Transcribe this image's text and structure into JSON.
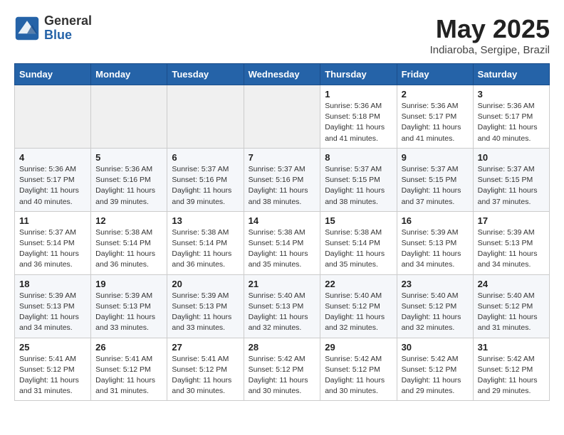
{
  "logo": {
    "general": "General",
    "blue": "Blue"
  },
  "header": {
    "month": "May 2025",
    "location": "Indiaroba, Sergipe, Brazil"
  },
  "days_of_week": [
    "Sunday",
    "Monday",
    "Tuesday",
    "Wednesday",
    "Thursday",
    "Friday",
    "Saturday"
  ],
  "weeks": [
    [
      {
        "day": "",
        "info": ""
      },
      {
        "day": "",
        "info": ""
      },
      {
        "day": "",
        "info": ""
      },
      {
        "day": "",
        "info": ""
      },
      {
        "day": "1",
        "info": "Sunrise: 5:36 AM\nSunset: 5:18 PM\nDaylight: 11 hours\nand 41 minutes."
      },
      {
        "day": "2",
        "info": "Sunrise: 5:36 AM\nSunset: 5:17 PM\nDaylight: 11 hours\nand 41 minutes."
      },
      {
        "day": "3",
        "info": "Sunrise: 5:36 AM\nSunset: 5:17 PM\nDaylight: 11 hours\nand 40 minutes."
      }
    ],
    [
      {
        "day": "4",
        "info": "Sunrise: 5:36 AM\nSunset: 5:17 PM\nDaylight: 11 hours\nand 40 minutes."
      },
      {
        "day": "5",
        "info": "Sunrise: 5:36 AM\nSunset: 5:16 PM\nDaylight: 11 hours\nand 39 minutes."
      },
      {
        "day": "6",
        "info": "Sunrise: 5:37 AM\nSunset: 5:16 PM\nDaylight: 11 hours\nand 39 minutes."
      },
      {
        "day": "7",
        "info": "Sunrise: 5:37 AM\nSunset: 5:16 PM\nDaylight: 11 hours\nand 38 minutes."
      },
      {
        "day": "8",
        "info": "Sunrise: 5:37 AM\nSunset: 5:15 PM\nDaylight: 11 hours\nand 38 minutes."
      },
      {
        "day": "9",
        "info": "Sunrise: 5:37 AM\nSunset: 5:15 PM\nDaylight: 11 hours\nand 37 minutes."
      },
      {
        "day": "10",
        "info": "Sunrise: 5:37 AM\nSunset: 5:15 PM\nDaylight: 11 hours\nand 37 minutes."
      }
    ],
    [
      {
        "day": "11",
        "info": "Sunrise: 5:37 AM\nSunset: 5:14 PM\nDaylight: 11 hours\nand 36 minutes."
      },
      {
        "day": "12",
        "info": "Sunrise: 5:38 AM\nSunset: 5:14 PM\nDaylight: 11 hours\nand 36 minutes."
      },
      {
        "day": "13",
        "info": "Sunrise: 5:38 AM\nSunset: 5:14 PM\nDaylight: 11 hours\nand 36 minutes."
      },
      {
        "day": "14",
        "info": "Sunrise: 5:38 AM\nSunset: 5:14 PM\nDaylight: 11 hours\nand 35 minutes."
      },
      {
        "day": "15",
        "info": "Sunrise: 5:38 AM\nSunset: 5:14 PM\nDaylight: 11 hours\nand 35 minutes."
      },
      {
        "day": "16",
        "info": "Sunrise: 5:39 AM\nSunset: 5:13 PM\nDaylight: 11 hours\nand 34 minutes."
      },
      {
        "day": "17",
        "info": "Sunrise: 5:39 AM\nSunset: 5:13 PM\nDaylight: 11 hours\nand 34 minutes."
      }
    ],
    [
      {
        "day": "18",
        "info": "Sunrise: 5:39 AM\nSunset: 5:13 PM\nDaylight: 11 hours\nand 34 minutes."
      },
      {
        "day": "19",
        "info": "Sunrise: 5:39 AM\nSunset: 5:13 PM\nDaylight: 11 hours\nand 33 minutes."
      },
      {
        "day": "20",
        "info": "Sunrise: 5:39 AM\nSunset: 5:13 PM\nDaylight: 11 hours\nand 33 minutes."
      },
      {
        "day": "21",
        "info": "Sunrise: 5:40 AM\nSunset: 5:13 PM\nDaylight: 11 hours\nand 32 minutes."
      },
      {
        "day": "22",
        "info": "Sunrise: 5:40 AM\nSunset: 5:12 PM\nDaylight: 11 hours\nand 32 minutes."
      },
      {
        "day": "23",
        "info": "Sunrise: 5:40 AM\nSunset: 5:12 PM\nDaylight: 11 hours\nand 32 minutes."
      },
      {
        "day": "24",
        "info": "Sunrise: 5:40 AM\nSunset: 5:12 PM\nDaylight: 11 hours\nand 31 minutes."
      }
    ],
    [
      {
        "day": "25",
        "info": "Sunrise: 5:41 AM\nSunset: 5:12 PM\nDaylight: 11 hours\nand 31 minutes."
      },
      {
        "day": "26",
        "info": "Sunrise: 5:41 AM\nSunset: 5:12 PM\nDaylight: 11 hours\nand 31 minutes."
      },
      {
        "day": "27",
        "info": "Sunrise: 5:41 AM\nSunset: 5:12 PM\nDaylight: 11 hours\nand 30 minutes."
      },
      {
        "day": "28",
        "info": "Sunrise: 5:42 AM\nSunset: 5:12 PM\nDaylight: 11 hours\nand 30 minutes."
      },
      {
        "day": "29",
        "info": "Sunrise: 5:42 AM\nSunset: 5:12 PM\nDaylight: 11 hours\nand 30 minutes."
      },
      {
        "day": "30",
        "info": "Sunrise: 5:42 AM\nSunset: 5:12 PM\nDaylight: 11 hours\nand 29 minutes."
      },
      {
        "day": "31",
        "info": "Sunrise: 5:42 AM\nSunset: 5:12 PM\nDaylight: 11 hours\nand 29 minutes."
      }
    ]
  ]
}
